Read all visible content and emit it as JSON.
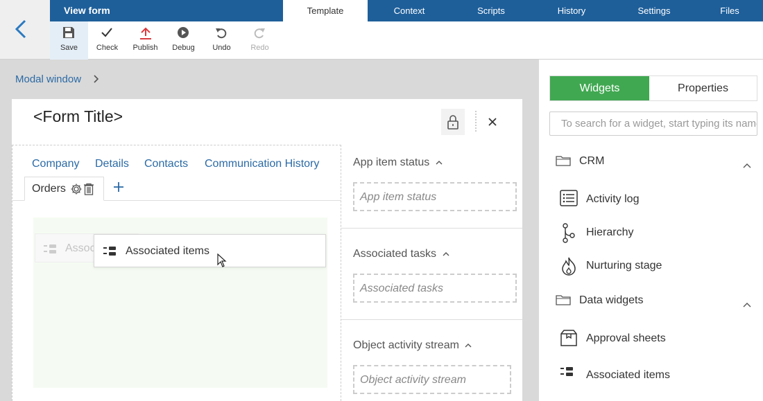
{
  "topbar": {
    "title": "View form",
    "tabs": [
      {
        "label": "Template"
      },
      {
        "label": "Context"
      },
      {
        "label": "Scripts"
      },
      {
        "label": "History"
      },
      {
        "label": "Settings"
      },
      {
        "label": "Files"
      }
    ]
  },
  "toolbar": {
    "save": "Save",
    "check": "Check",
    "publish": "Publish",
    "debug": "Debug",
    "undo": "Undo",
    "redo": "Redo"
  },
  "breadcrumb": "Modal window",
  "form": {
    "title": "<Form Title>",
    "tabs": [
      "Company",
      "Details",
      "Contacts",
      "Communication History"
    ],
    "active_tab": "Orders",
    "ghost_item": "Assoc",
    "dragged_item": "Associated items",
    "sections": [
      {
        "title": "App item status",
        "placeholder": "App item status"
      },
      {
        "title": "Associated tasks",
        "placeholder": "Associated tasks"
      },
      {
        "title": "Object activity stream",
        "placeholder": "Object activity stream"
      }
    ]
  },
  "panel": {
    "widgets_tab": "Widgets",
    "properties_tab": "Properties",
    "search_placeholder": "To search for a widget, start typing its name",
    "groups": [
      {
        "name": "CRM",
        "items": [
          "Activity log",
          "Hierarchy",
          "Nurturing stage"
        ]
      },
      {
        "name": "Data widgets",
        "items": [
          "Approval sheets",
          "Associated items"
        ]
      }
    ]
  },
  "colors": {
    "nav": "#1e5f9a",
    "accent_green": "#40a851",
    "link": "#2b6aa5"
  }
}
